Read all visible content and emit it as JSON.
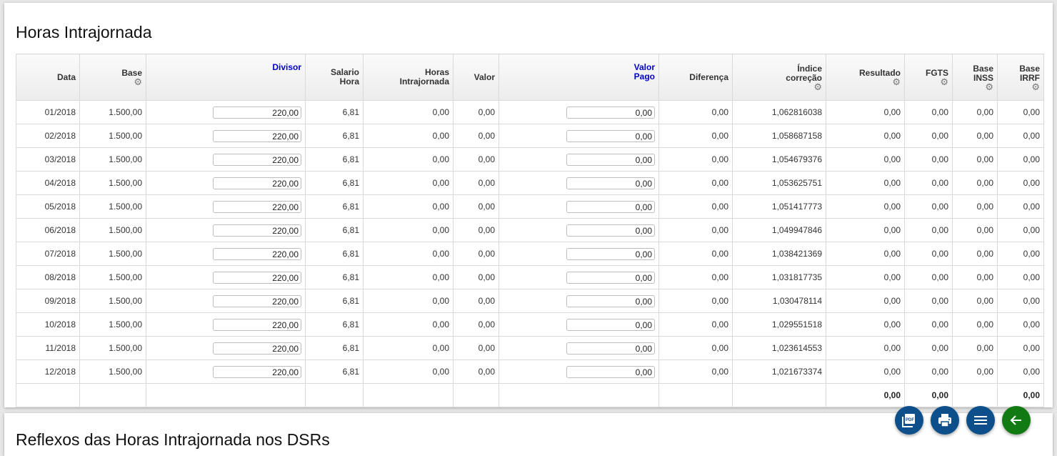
{
  "section": {
    "title": "Horas Intrajornada",
    "next_title": "Reflexos das Horas Intrajornada nos DSRs"
  },
  "columns": [
    {
      "key": "data",
      "label": [
        "Data"
      ],
      "gear": false,
      "blue": false
    },
    {
      "key": "base",
      "label": [
        "Base"
      ],
      "gear": true,
      "blue": false
    },
    {
      "key": "divisor",
      "label": [
        "Divisor"
      ],
      "gear": false,
      "blue": true
    },
    {
      "key": "salario_hora",
      "label": [
        "Salario",
        "Hora"
      ],
      "gear": false,
      "blue": false
    },
    {
      "key": "horas_intrajornada",
      "label": [
        "Horas",
        "Intrajornada"
      ],
      "gear": false,
      "blue": false
    },
    {
      "key": "valor",
      "label": [
        "Valor"
      ],
      "gear": false,
      "blue": false
    },
    {
      "key": "valor_pago",
      "label": [
        "Valor",
        "Pago"
      ],
      "gear": false,
      "blue": true
    },
    {
      "key": "diferenca",
      "label": [
        "Diferença"
      ],
      "gear": false,
      "blue": false
    },
    {
      "key": "indice",
      "label": [
        "Índice",
        "correção"
      ],
      "gear": true,
      "blue": false
    },
    {
      "key": "resultado",
      "label": [
        "Resultado"
      ],
      "gear": true,
      "blue": false
    },
    {
      "key": "fgts",
      "label": [
        "FGTS"
      ],
      "gear": true,
      "blue": false
    },
    {
      "key": "base_inss",
      "label": [
        "Base",
        "INSS"
      ],
      "gear": true,
      "blue": false
    },
    {
      "key": "base_irrf",
      "label": [
        "Base",
        "IRRF"
      ],
      "gear": true,
      "blue": false
    }
  ],
  "rows": [
    {
      "data": "01/2018",
      "base": "1.500,00",
      "divisor": "220,00",
      "salario_hora": "6,81",
      "horas_intrajornada": "0,00",
      "valor": "0,00",
      "valor_pago": "0,00",
      "diferenca": "0,00",
      "indice": "1,062816038",
      "resultado": "0,00",
      "fgts": "0,00",
      "base_inss": "0,00",
      "base_irrf": "0,00"
    },
    {
      "data": "02/2018",
      "base": "1.500,00",
      "divisor": "220,00",
      "salario_hora": "6,81",
      "horas_intrajornada": "0,00",
      "valor": "0,00",
      "valor_pago": "0,00",
      "diferenca": "0,00",
      "indice": "1,058687158",
      "resultado": "0,00",
      "fgts": "0,00",
      "base_inss": "0,00",
      "base_irrf": "0,00"
    },
    {
      "data": "03/2018",
      "base": "1.500,00",
      "divisor": "220,00",
      "salario_hora": "6,81",
      "horas_intrajornada": "0,00",
      "valor": "0,00",
      "valor_pago": "0,00",
      "diferenca": "0,00",
      "indice": "1,054679376",
      "resultado": "0,00",
      "fgts": "0,00",
      "base_inss": "0,00",
      "base_irrf": "0,00"
    },
    {
      "data": "04/2018",
      "base": "1.500,00",
      "divisor": "220,00",
      "salario_hora": "6,81",
      "horas_intrajornada": "0,00",
      "valor": "0,00",
      "valor_pago": "0,00",
      "diferenca": "0,00",
      "indice": "1,053625751",
      "resultado": "0,00",
      "fgts": "0,00",
      "base_inss": "0,00",
      "base_irrf": "0,00"
    },
    {
      "data": "05/2018",
      "base": "1.500,00",
      "divisor": "220,00",
      "salario_hora": "6,81",
      "horas_intrajornada": "0,00",
      "valor": "0,00",
      "valor_pago": "0,00",
      "diferenca": "0,00",
      "indice": "1,051417773",
      "resultado": "0,00",
      "fgts": "0,00",
      "base_inss": "0,00",
      "base_irrf": "0,00"
    },
    {
      "data": "06/2018",
      "base": "1.500,00",
      "divisor": "220,00",
      "salario_hora": "6,81",
      "horas_intrajornada": "0,00",
      "valor": "0,00",
      "valor_pago": "0,00",
      "diferenca": "0,00",
      "indice": "1,049947846",
      "resultado": "0,00",
      "fgts": "0,00",
      "base_inss": "0,00",
      "base_irrf": "0,00"
    },
    {
      "data": "07/2018",
      "base": "1.500,00",
      "divisor": "220,00",
      "salario_hora": "6,81",
      "horas_intrajornada": "0,00",
      "valor": "0,00",
      "valor_pago": "0,00",
      "diferenca": "0,00",
      "indice": "1,038421369",
      "resultado": "0,00",
      "fgts": "0,00",
      "base_inss": "0,00",
      "base_irrf": "0,00"
    },
    {
      "data": "08/2018",
      "base": "1.500,00",
      "divisor": "220,00",
      "salario_hora": "6,81",
      "horas_intrajornada": "0,00",
      "valor": "0,00",
      "valor_pago": "0,00",
      "diferenca": "0,00",
      "indice": "1,031817735",
      "resultado": "0,00",
      "fgts": "0,00",
      "base_inss": "0,00",
      "base_irrf": "0,00"
    },
    {
      "data": "09/2018",
      "base": "1.500,00",
      "divisor": "220,00",
      "salario_hora": "6,81",
      "horas_intrajornada": "0,00",
      "valor": "0,00",
      "valor_pago": "0,00",
      "diferenca": "0,00",
      "indice": "1,030478114",
      "resultado": "0,00",
      "fgts": "0,00",
      "base_inss": "0,00",
      "base_irrf": "0,00"
    },
    {
      "data": "10/2018",
      "base": "1.500,00",
      "divisor": "220,00",
      "salario_hora": "6,81",
      "horas_intrajornada": "0,00",
      "valor": "0,00",
      "valor_pago": "0,00",
      "diferenca": "0,00",
      "indice": "1,029551518",
      "resultado": "0,00",
      "fgts": "0,00",
      "base_inss": "0,00",
      "base_irrf": "0,00"
    },
    {
      "data": "11/2018",
      "base": "1.500,00",
      "divisor": "220,00",
      "salario_hora": "6,81",
      "horas_intrajornada": "0,00",
      "valor": "0,00",
      "valor_pago": "0,00",
      "diferenca": "0,00",
      "indice": "1,023614553",
      "resultado": "0,00",
      "fgts": "0,00",
      "base_inss": "0,00",
      "base_irrf": "0,00"
    },
    {
      "data": "12/2018",
      "base": "1.500,00",
      "divisor": "220,00",
      "salario_hora": "6,81",
      "horas_intrajornada": "0,00",
      "valor": "0,00",
      "valor_pago": "0,00",
      "diferenca": "0,00",
      "indice": "1,021673374",
      "resultado": "0,00",
      "fgts": "0,00",
      "base_inss": "0,00",
      "base_irrf": "0,00"
    }
  ],
  "totals": {
    "resultado": "0,00",
    "fgts": "0,00",
    "base_irrf": "0,00"
  },
  "actions": [
    {
      "name": "pdf-button",
      "icon": "pdf-icon",
      "color": "#0d4f8b"
    },
    {
      "name": "print-button",
      "icon": "printer-icon",
      "color": "#0d4f8b"
    },
    {
      "name": "menu-button",
      "icon": "menu-icon",
      "color": "#0d4f8b"
    },
    {
      "name": "back-button",
      "icon": "arrow-left-icon",
      "color": "#127a12"
    }
  ]
}
